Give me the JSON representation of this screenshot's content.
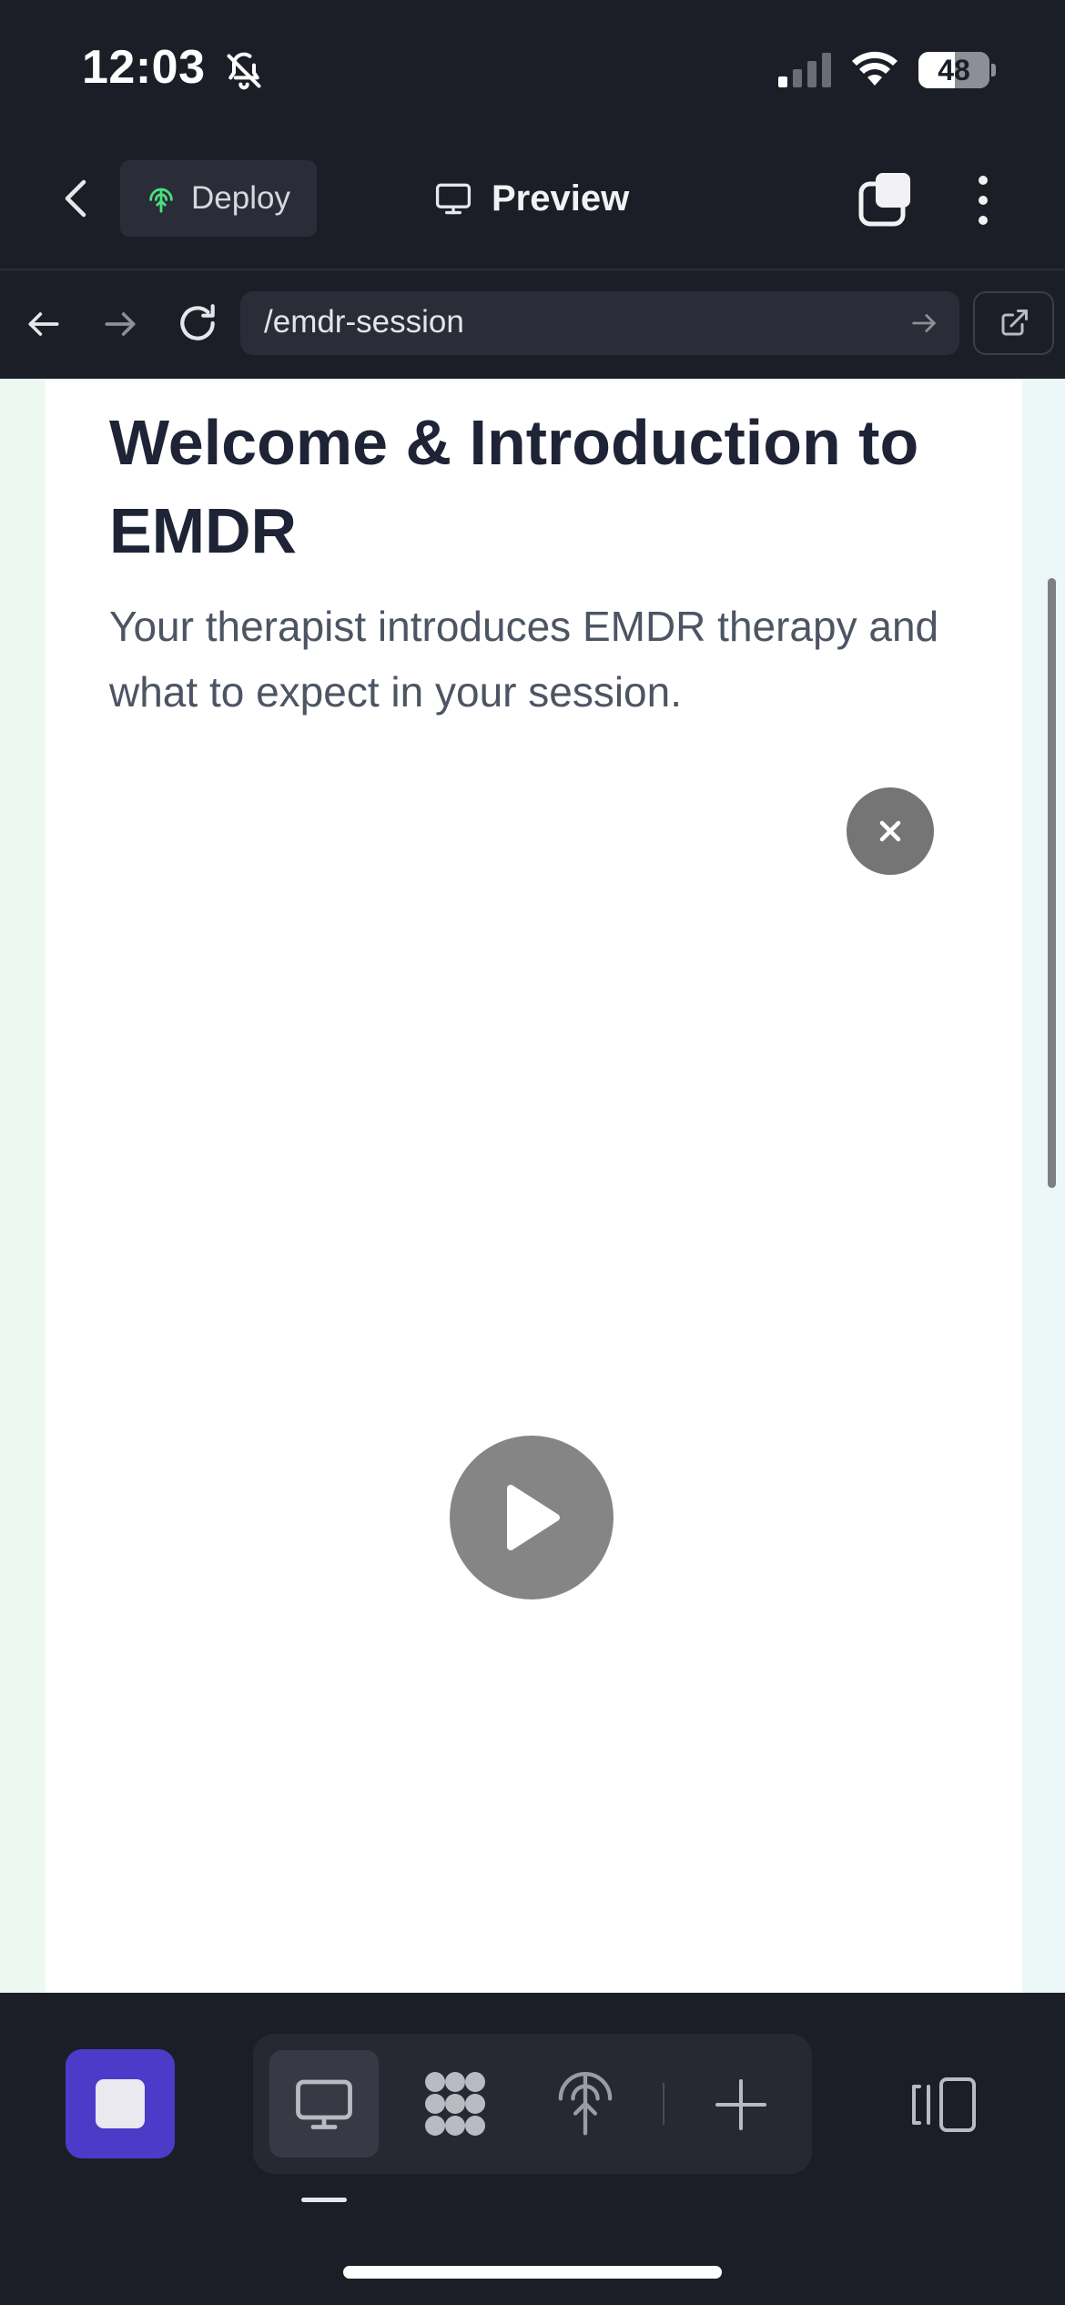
{
  "status_bar": {
    "time": "12:03",
    "battery_level": "48",
    "icons": [
      "bell-slash-icon",
      "cellular-signal-icon",
      "wifi-icon",
      "battery-icon"
    ]
  },
  "top_nav": {
    "back_icon": "chevron-left-icon",
    "deploy_label": "Deploy",
    "deploy_icon": "deploy-tree-icon",
    "preview_label": "Preview",
    "preview_icon": "monitor-icon",
    "tabs_icon": "tabs-icon",
    "more_icon": "more-vertical-icon"
  },
  "url_bar": {
    "back_icon": "arrow-left-icon",
    "forward_icon": "arrow-right-icon",
    "reload_icon": "reload-icon",
    "url": "/emdr-session",
    "go_icon": "arrow-right-icon",
    "open_external_icon": "external-link-icon"
  },
  "page": {
    "title": "Welcome & Introduction to EMDR",
    "subtitle": "Your therapist introduces EMDR therapy and what to expect in your session.",
    "close_icon": "close-icon",
    "play_icon": "play-icon"
  },
  "toolbar": {
    "items": [
      {
        "name": "stop",
        "icon": "stop-icon"
      },
      {
        "name": "preview",
        "icon": "monitor-icon",
        "active": true
      },
      {
        "name": "modules",
        "icon": "modules-icon"
      },
      {
        "name": "deploy",
        "icon": "deploy-tree-icon"
      },
      {
        "name": "add",
        "icon": "plus-icon"
      },
      {
        "name": "panels",
        "icon": "panels-icon"
      }
    ]
  },
  "colors": {
    "app_bg": "#1c1e27",
    "accent": "#4b3bc9",
    "deploy_icon": "#4ade80",
    "title_text": "#1e2336",
    "subtitle_text": "#4d5564"
  }
}
